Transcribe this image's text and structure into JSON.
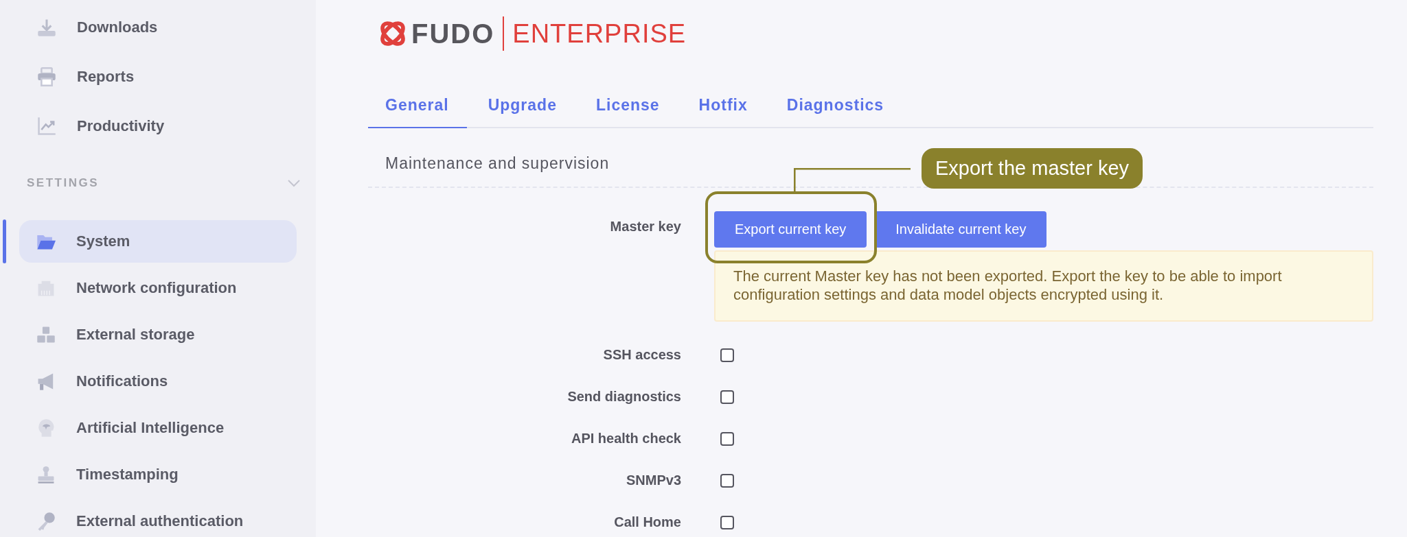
{
  "sidebar": {
    "items": [
      {
        "label": "Downloads",
        "selected": false
      },
      {
        "label": "Reports",
        "selected": false
      },
      {
        "label": "Productivity",
        "selected": false
      }
    ],
    "section": {
      "title": "SETTINGS",
      "expanded": true,
      "items": [
        {
          "label": "System",
          "selected": true
        },
        {
          "label": "Network configuration",
          "selected": false
        },
        {
          "label": "External storage",
          "selected": false
        },
        {
          "label": "Notifications",
          "selected": false
        },
        {
          "label": "Artificial Intelligence",
          "selected": false
        },
        {
          "label": "Timestamping",
          "selected": false
        },
        {
          "label": "External authentication",
          "selected": false
        }
      ]
    }
  },
  "logo": {
    "brand": "FUDO",
    "edition": "ENTERPRISE"
  },
  "tabs": [
    {
      "label": "General",
      "selected": true
    },
    {
      "label": "Upgrade",
      "selected": false
    },
    {
      "label": "License",
      "selected": false
    },
    {
      "label": "Hotfix",
      "selected": false
    },
    {
      "label": "Diagnostics",
      "selected": false
    }
  ],
  "section_title": "Maintenance and supervision",
  "master_key": {
    "label": "Master key",
    "buttons": [
      "Export current key",
      "Invalidate current key"
    ],
    "warning": "The current Master key has not been exported. Export the key to be able to import configuration settings and data model objects encrypted using it."
  },
  "options": [
    {
      "label": "SSH access",
      "checked": false
    },
    {
      "label": "Send diagnostics",
      "checked": false
    },
    {
      "label": "API health check",
      "checked": false
    },
    {
      "label": "SNMPv3",
      "checked": false
    },
    {
      "label": "Call Home",
      "checked": false
    }
  ],
  "callout": {
    "text": "Export the master key"
  }
}
